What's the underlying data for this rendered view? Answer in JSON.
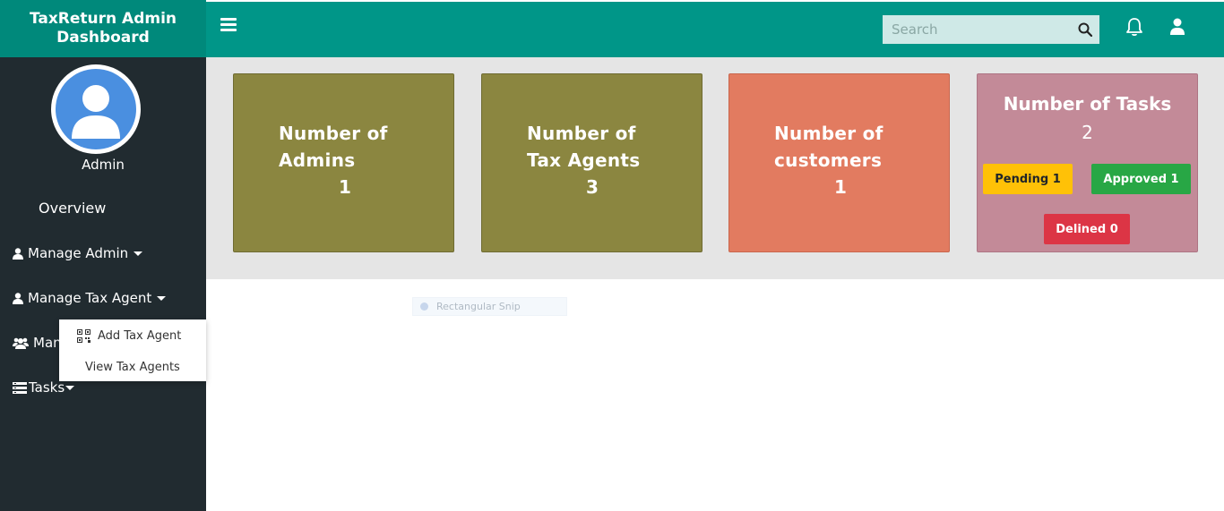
{
  "sidebar": {
    "brand": "TaxReturn Admin Dashboard",
    "user_label": "Admin",
    "items": [
      {
        "label": "Overview",
        "icon": ""
      },
      {
        "label": "Manage Admin",
        "icon": "user-icon"
      },
      {
        "label": "Manage Tax Agent",
        "icon": "user-icon"
      },
      {
        "label": "Man",
        "icon": "users-icon"
      },
      {
        "label": "Tasks",
        "icon": "list-icon"
      }
    ]
  },
  "dropdown": {
    "items": [
      {
        "label": "Add Tax Agent",
        "icon": "qr-grid-icon"
      },
      {
        "label": "View Tax Agents"
      }
    ]
  },
  "header": {
    "search_placeholder": "Search",
    "icons": [
      "menu-icon",
      "search-icon",
      "bell-icon",
      "user-icon"
    ]
  },
  "stats": {
    "admins": {
      "title_line1": "Number of",
      "title_line2": "Admins",
      "count": "1"
    },
    "agents": {
      "title_line1": "Number of",
      "title_line2": "Tax Agents",
      "count": "3"
    },
    "customers": {
      "title_line1": "Number of",
      "title_line2": "customers",
      "count": "1"
    },
    "tasks": {
      "title": "Number of Tasks",
      "count": "2",
      "pending": "Pending 1",
      "approved": "Approved 1",
      "declined": "Delined 0"
    }
  },
  "overlay": {
    "snip_label": "Rectangular Snip"
  },
  "colors": {
    "header": "#009688",
    "brand": "#00897b",
    "sidebar": "#212b30",
    "card_olive": "#8b8640",
    "card_orange": "#e27b60",
    "card_pink": "#c38a98",
    "pending": "#ffc107",
    "approved": "#28a745",
    "declined": "#dc3545"
  }
}
